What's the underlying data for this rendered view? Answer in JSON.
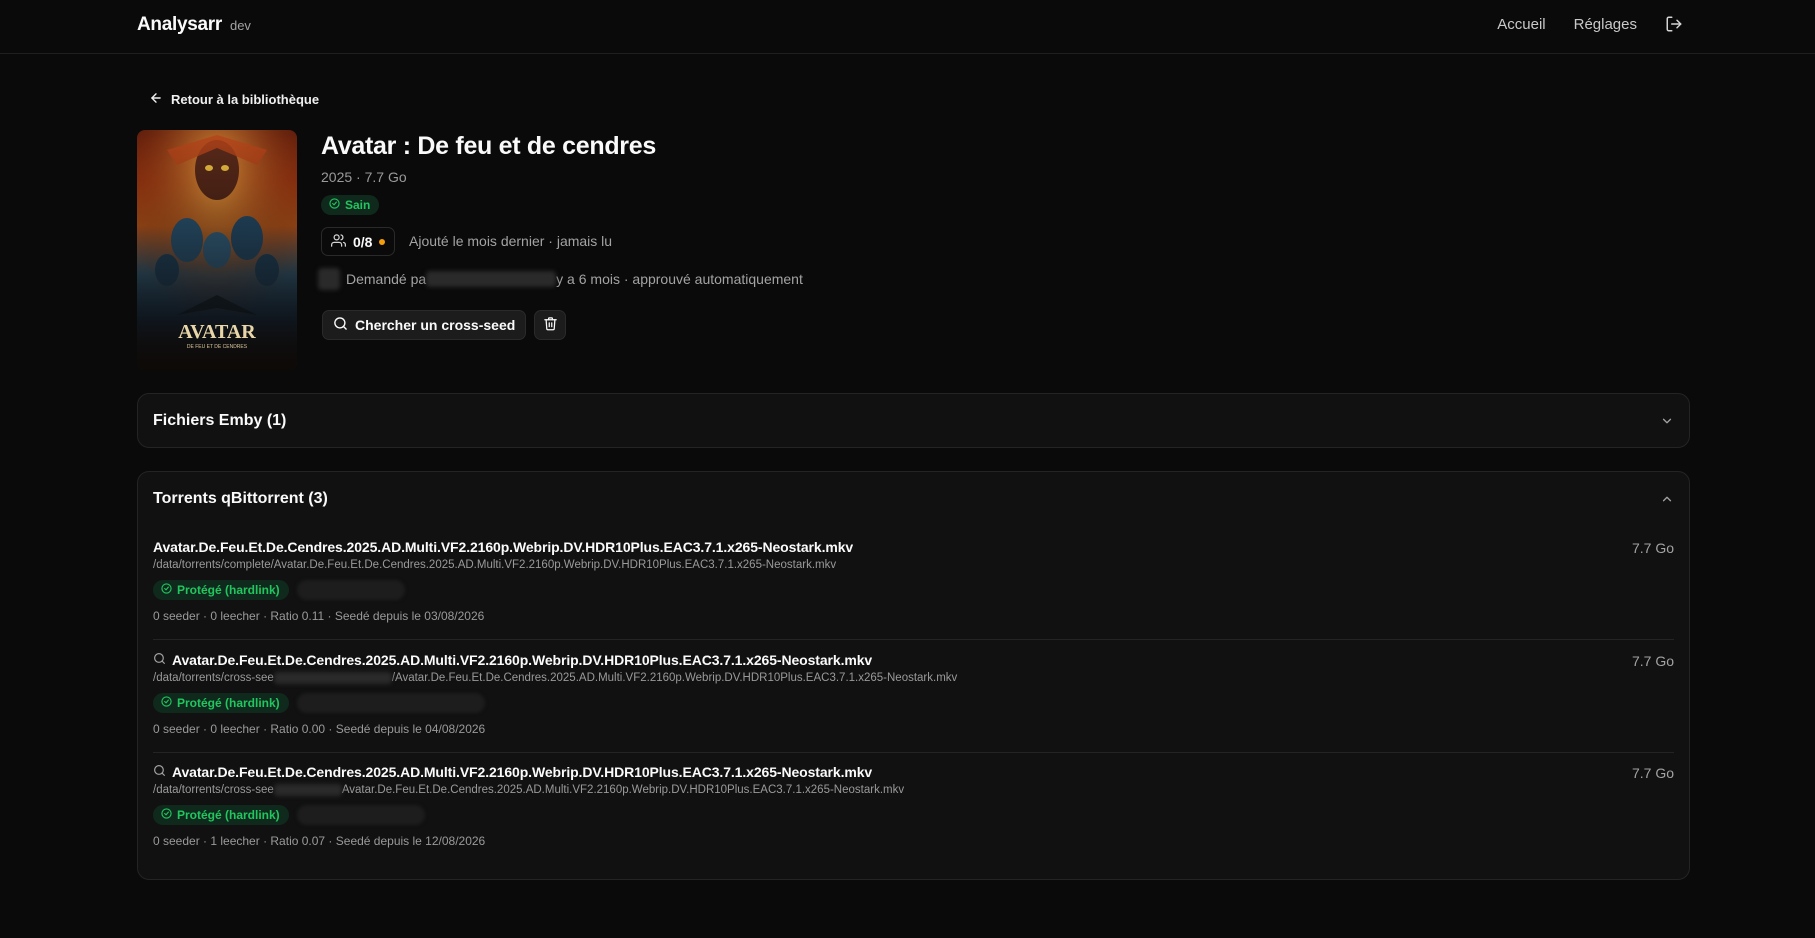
{
  "app": {
    "name": "Analysarr",
    "env_tag": "dev"
  },
  "nav": {
    "home": "Accueil",
    "settings": "Réglages"
  },
  "back_link": "Retour à la bibliothèque",
  "movie": {
    "title": "Avatar : De feu et de cendres",
    "meta": "2025 · 7.7 Go",
    "health_badge": "Sain",
    "viewers": "0/8",
    "added_info": "Ajouté le mois dernier · jamais lu",
    "request_prefix": "Demandé pa",
    "request_suffix": "y a 6 mois · approuvé automatiquement",
    "poster_title": "AVATAR",
    "poster_subtitle": "DE FEU ET DE CENDRES"
  },
  "actions": {
    "cross_seed": "Chercher un cross-seed"
  },
  "emby_section": {
    "title": "Fichiers Emby (1)"
  },
  "torrents_section": {
    "title": "Torrents qBittorrent (3)",
    "items": [
      {
        "name": "Avatar.De.Feu.Et.De.Cendres.2025.AD.Multi.VF2.2160p.Webrip.DV.HDR10Plus.EAC3.7.1.x265-Neostark.mkv",
        "path_start": "/data/torrents/complete/Avatar.De.Feu.Et.De.Cendres.2025.AD.Multi.VF2.2160p.Webrip.DV.HDR10Plus.EAC3.7.1.x265-Neostark.mkv",
        "path_end": "",
        "size": "7.7 Go",
        "badge": "Protégé (hardlink)",
        "stats": "0 seeder · 0 leecher · Ratio 0.11 · Seedé depuis le 03/08/2026"
      },
      {
        "name": "Avatar.De.Feu.Et.De.Cendres.2025.AD.Multi.VF2.2160p.Webrip.DV.HDR10Plus.EAC3.7.1.x265-Neostark.mkv",
        "path_start": "/data/torrents/cross-see",
        "path_end": "/Avatar.De.Feu.Et.De.Cendres.2025.AD.Multi.VF2.2160p.Webrip.DV.HDR10Plus.EAC3.7.1.x265-Neostark.mkv",
        "size": "7.7 Go",
        "badge": "Protégé (hardlink)",
        "stats": "0 seeder · 0 leecher · Ratio 0.00 · Seedé depuis le 04/08/2026"
      },
      {
        "name": "Avatar.De.Feu.Et.De.Cendres.2025.AD.Multi.VF2.2160p.Webrip.DV.HDR10Plus.EAC3.7.1.x265-Neostark.mkv",
        "path_start": "/data/torrents/cross-see",
        "path_end": "Avatar.De.Feu.Et.De.Cendres.2025.AD.Multi.VF2.2160p.Webrip.DV.HDR10Plus.EAC3.7.1.x265-Neostark.mkv",
        "size": "7.7 Go",
        "badge": "Protégé (hardlink)",
        "stats": "0 seeder · 1 leecher · Ratio 0.07 · Seedé depuis le 12/08/2026"
      }
    ]
  },
  "colors": {
    "accent_green": "#22c55e",
    "warning_dot": "#f59e0b",
    "background": "#0a0a0a",
    "card": "#111111"
  }
}
